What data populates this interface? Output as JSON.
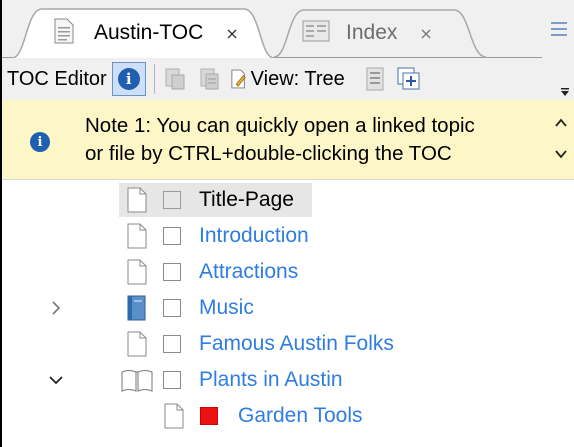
{
  "tabs": [
    {
      "title": "Austin-TOC",
      "close": "×",
      "active": true
    },
    {
      "title": "Index",
      "close": "×",
      "active": false
    }
  ],
  "toolbar": {
    "label": "TOC Editor",
    "view_label": "View: Tree"
  },
  "note": {
    "line1": "Note 1: You can quickly open a linked topic",
    "line2": "or file by CTRL+double-clicking the TOC"
  },
  "tree": {
    "items": [
      {
        "label": "Title-Page",
        "selected": true,
        "icon": "document-icon"
      },
      {
        "label": "Introduction",
        "icon": "document-icon"
      },
      {
        "label": "Attractions",
        "icon": "document-icon"
      },
      {
        "label": "Music",
        "icon": "book-closed-icon",
        "expander": "collapsed"
      },
      {
        "label": "Famous Austin Folks",
        "icon": "document-icon"
      },
      {
        "label": "Plants in Austin",
        "icon": "book-open-icon",
        "expander": "expanded"
      },
      {
        "label": "Garden Tools",
        "icon": "document-icon",
        "child": true,
        "checkbox_color": "#ee1111"
      }
    ]
  },
  "colors": {
    "link": "#2f7de1",
    "note_bg": "#fdf7c8",
    "info_blue": "#1f5fb0"
  }
}
